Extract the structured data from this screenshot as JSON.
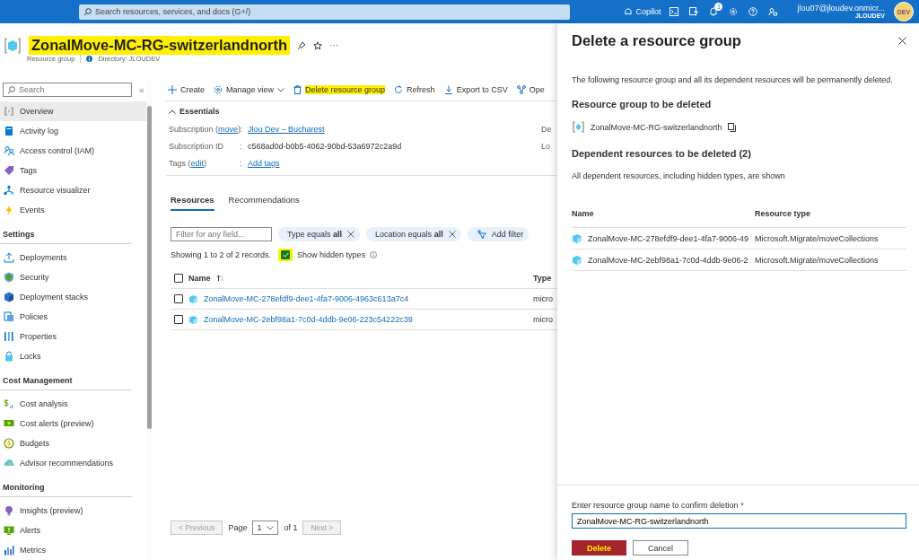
{
  "topbar": {
    "search": {
      "placeholder": "Search resources, services, and docs (G+/)"
    },
    "copilot": "Copilot",
    "notification_count": "1",
    "account": {
      "email": "jlou07@jloudev.onmicr...",
      "directory": "JLOUDEV",
      "avatar": "DEV"
    }
  },
  "header": {
    "title": "ZonalMove-MC-RG-switzerlandnorth",
    "highlighted": true,
    "subtitle": "Resource group",
    "directory": "Directory: JLOUDEV",
    "more": "···"
  },
  "sidebar": {
    "search": {
      "placeholder": "Search"
    },
    "collapse": "«",
    "groups": [
      {
        "items": [
          {
            "label": "Overview",
            "selected": true
          },
          {
            "label": "Activity log",
            "selected": false
          },
          {
            "label": "Access control (IAM)",
            "selected": false
          },
          {
            "label": "Tags",
            "selected": false
          },
          {
            "label": "Resource visualizer",
            "selected": false
          },
          {
            "label": "Events",
            "selected": false
          }
        ]
      },
      {
        "heading": "Settings",
        "items": [
          {
            "label": "Deployments",
            "selected": false
          },
          {
            "label": "Security",
            "selected": false
          },
          {
            "label": "Deployment stacks",
            "selected": false
          },
          {
            "label": "Policies",
            "selected": false
          },
          {
            "label": "Properties",
            "selected": false
          },
          {
            "label": "Locks",
            "selected": false
          }
        ]
      },
      {
        "heading": "Cost Management",
        "items": [
          {
            "label": "Cost analysis",
            "selected": false
          },
          {
            "label": "Cost alerts (preview)",
            "selected": false
          },
          {
            "label": "Budgets",
            "selected": false
          },
          {
            "label": "Advisor recommendations",
            "selected": false
          }
        ]
      },
      {
        "heading": "Monitoring",
        "items": [
          {
            "label": "Insights (preview)",
            "selected": false
          },
          {
            "label": "Alerts",
            "selected": false
          },
          {
            "label": "Metrics",
            "selected": false
          }
        ]
      }
    ]
  },
  "toolbar": [
    {
      "label": "Create",
      "highlighted": false
    },
    {
      "label": "Manage view",
      "highlighted": false
    },
    {
      "label": "Delete resource group",
      "highlighted": true
    },
    {
      "label": "Refresh",
      "highlighted": false
    },
    {
      "label": "Export to CSV",
      "highlighted": false
    },
    {
      "label": "Ope",
      "highlighted": false
    }
  ],
  "essentials": {
    "title": "Essentials",
    "expanded": true,
    "rows": [
      {
        "label": "Subscription (",
        "label_link": "move",
        "label_end": ")",
        "separator": ":",
        "value": "Jlou Dev – Bucharest",
        "kind": "link",
        "column_2": "De"
      },
      {
        "label": "Subscription ID",
        "separator": ":",
        "value": "c568ad0d-b0b5-4062-90bd-53a6972c2a9d",
        "kind": "text",
        "column_2": "Lo"
      },
      {
        "label": "Tags (",
        "label_link": "edit",
        "label_end": ")",
        "separator": ":",
        "value": "Add tags",
        "kind": "link"
      }
    ]
  },
  "tabs": [
    {
      "label": "Resources",
      "selected": true
    },
    {
      "label": "Recommendations",
      "selected": false
    }
  ],
  "filters": {
    "placeholder": "Filter for any field...",
    "pills": [
      "Type equals **all**",
      "Location equals **all**"
    ],
    "add_filter": "Add filter"
  },
  "records": "Showing 1 to 2 of 2 records.",
  "show_hidden": {
    "label": "Show hidden types",
    "checked": true,
    "highlighted": true
  },
  "table": {
    "columns": [
      "Name",
      "Type"
    ],
    "all_checked": false,
    "rows": [
      {
        "name": "ZonalMove-MC-278efdf9-dee1-4fa7-9006-4963c613a7c4",
        "type": "micro",
        "checked": false
      },
      {
        "name": "ZonalMove-MC-2ebf98a1-7c0d-4ddb-9e06-223c54222c39",
        "type": "micro",
        "checked": false
      }
    ]
  },
  "pagination": {
    "previous": "< Previous",
    "page_label": "Page",
    "page": "1",
    "of": "of 1",
    "next": "Next >"
  },
  "panel": {
    "title": "Delete a resource group",
    "description": "The following resource group and all its dependent resources will be permanently deleted.",
    "group_heading": "Resource group to be deleted",
    "group_name": "ZonalMove-MC-RG-switzerlandnorth",
    "dependents_heading": "Dependent resources to be deleted (2)",
    "dependents_note": "All dependent resources, including hidden types, are shown",
    "columns": [
      "Name",
      "Resource type"
    ],
    "rows": [
      {
        "name": "ZonalMove-MC-278efdf9-dee1-4fa7-9006-49",
        "type": "Microsoft.Migrate/moveCollections"
      },
      {
        "name": "ZonalMove-MC-2ebf98a1-7c0d-4ddb-9e06-2",
        "type": "Microsoft.Migrate/moveCollections"
      }
    ],
    "confirm_label": "Enter resource group name to confirm deletion",
    "required_mark": "*",
    "confirm_value": "ZonalMove-MC-RG-switzerlandnorth",
    "buttons": [
      {
        "label": "Delete",
        "kind": "primary",
        "highlighted": true
      },
      {
        "label": "Cancel",
        "kind": "secondary",
        "highlighted": false
      }
    ]
  }
}
